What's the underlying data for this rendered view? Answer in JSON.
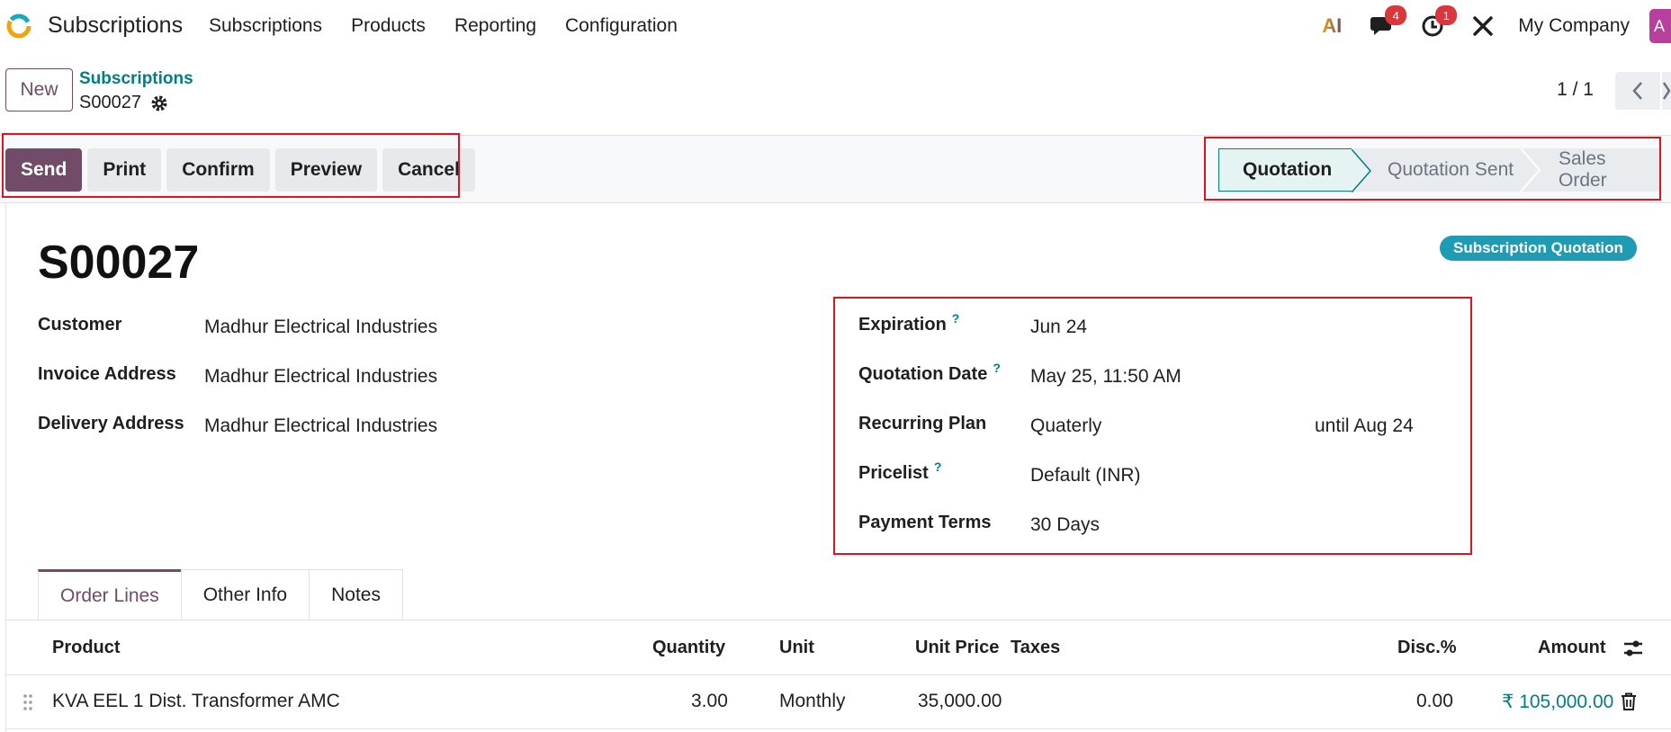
{
  "nav": {
    "app_name": "Subscriptions",
    "menu": [
      "Subscriptions",
      "Products",
      "Reporting",
      "Configuration"
    ],
    "messages_badge": "4",
    "activities_badge": "1",
    "company": "My Company",
    "avatar_letter": "A",
    "ai_label": "AI"
  },
  "control": {
    "new_label": "New",
    "breadcrumb_parent": "Subscriptions",
    "breadcrumb_current": "S00027",
    "pager": "1 / 1"
  },
  "actions": {
    "send": "Send",
    "print": "Print",
    "confirm": "Confirm",
    "preview": "Preview",
    "cancel": "Cancel"
  },
  "stages": {
    "quotation": "Quotation",
    "quotation_sent": "Quotation Sent",
    "sales_order": "Sales Order",
    "active": "Quotation"
  },
  "record": {
    "tag": "Subscription Quotation",
    "title": "S00027",
    "left": {
      "customer_label": "Customer",
      "customer": "Madhur Electrical Industries",
      "invoice_label": "Invoice Address",
      "invoice": "Madhur Electrical Industries",
      "delivery_label": "Delivery Address",
      "delivery": "Madhur Electrical Industries"
    },
    "right": {
      "expiration_label": "Expiration",
      "expiration": "Jun 24",
      "quotation_date_label": "Quotation Date",
      "quotation_date": "May 25, 11:50 AM",
      "plan_label": "Recurring Plan",
      "plan": "Quaterly",
      "plan_until": "until Aug 24",
      "pricelist_label": "Pricelist",
      "pricelist": "Default (INR)",
      "payment_terms_label": "Payment Terms",
      "payment_terms": "30 Days"
    },
    "help_mark": "?"
  },
  "tabs": [
    "Order Lines",
    "Other Info",
    "Notes"
  ],
  "table": {
    "headers": {
      "product": "Product",
      "quantity": "Quantity",
      "unit": "Unit",
      "unit_price": "Unit Price",
      "taxes": "Taxes",
      "disc": "Disc.%",
      "amount": "Amount"
    },
    "rows": [
      {
        "product": "KVA EEL 1 Dist. Transformer AMC",
        "quantity": "3.00",
        "unit": "Monthly",
        "unit_price": "35,000.00",
        "taxes": "",
        "disc": "0.00",
        "amount": "₹ 105,000.00"
      }
    ]
  },
  "colors": {
    "primary": "#714b67",
    "teal": "#017e84",
    "badge_red": "#d9363e",
    "highlight_red": "#e0141e",
    "tag": "#1f9cb4"
  }
}
